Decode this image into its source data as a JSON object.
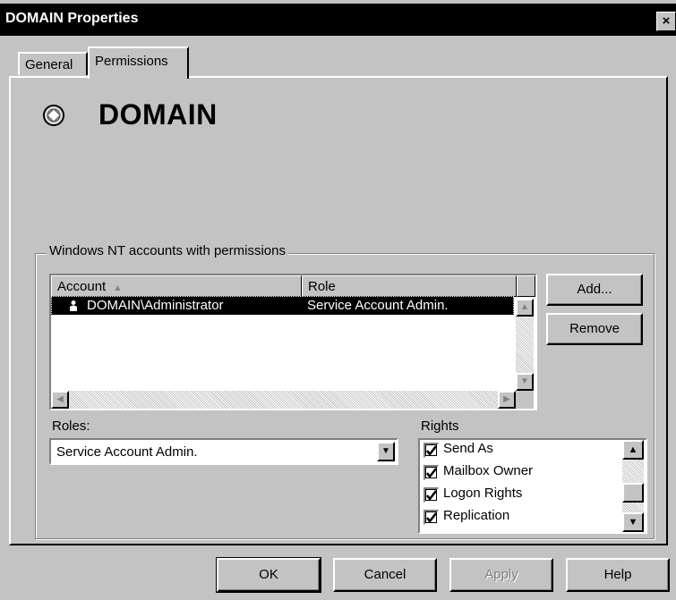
{
  "window": {
    "title": "DOMAIN Properties",
    "close_glyph": "×"
  },
  "tabs": [
    {
      "label": "General",
      "active": false
    },
    {
      "label": "Permissions",
      "active": true
    }
  ],
  "header": {
    "object_name": "DOMAIN",
    "icon": "domain-globe-icon"
  },
  "permissions": {
    "group_label": "Windows NT accounts with permissions",
    "columns": {
      "account": "Account",
      "role": "Role",
      "sort_glyph": "▲"
    },
    "rows": [
      {
        "account": "DOMAIN\\Administrator",
        "role": "Service Account Admin.",
        "icon": "user-icon",
        "selected": true
      }
    ],
    "add_label": "Add...",
    "remove_label": "Remove"
  },
  "roles": {
    "label": "Roles:",
    "value": "Service Account Admin."
  },
  "rights": {
    "label": "Rights",
    "items": [
      {
        "label": "Send As",
        "checked": true
      },
      {
        "label": "Mailbox Owner",
        "checked": true
      },
      {
        "label": "Logon Rights",
        "checked": true
      },
      {
        "label": "Replication",
        "checked": true
      }
    ]
  },
  "buttons": {
    "ok": "OK",
    "cancel": "Cancel",
    "apply": "Apply",
    "help": "Help"
  }
}
